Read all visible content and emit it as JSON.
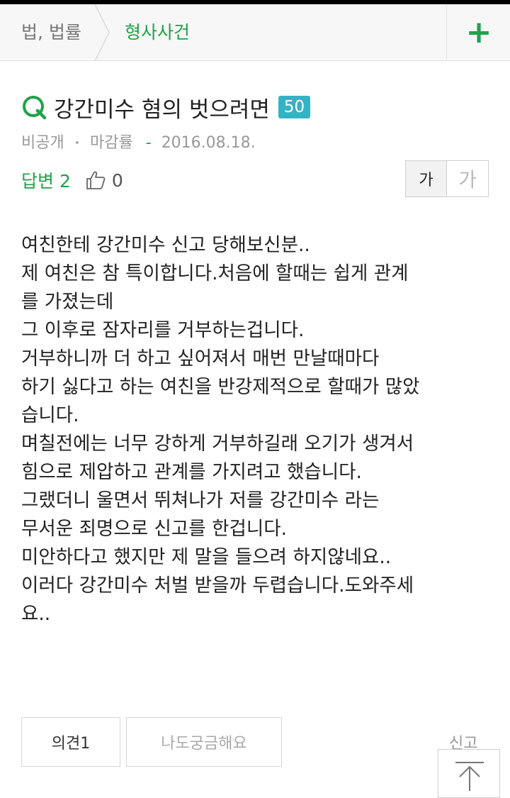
{
  "breadcrumb": {
    "category": "법, 법률",
    "subcategory": "형사사건",
    "add_symbol": "+"
  },
  "question": {
    "title": "강간미수 혐의 벗으려면",
    "points": "50",
    "author": "비공개",
    "close_rate_label": "마감률",
    "close_rate_value": "-",
    "date": "2016.08.18.",
    "answers_label": "답변 2",
    "likes": "0",
    "body_lines": [
      "여친한테 강간미수 신고 당해보신분..",
      "제 여친은 참 특이합니다.처음에 할때는 쉽게 관계",
      "를 가졌는데",
      "그 이후로 잠자리를 거부하는겁니다.",
      "거부하니까 더 하고 싶어져서 매번 만날때마다",
      "하기 싫다고 하는 여친을 반강제적으로 할때가 많았",
      "습니다.",
      "며칠전에는 너무 강하게 거부하길래 오기가 생겨서",
      "힘으로 제압하고 관계를 가지려고 했습니다.",
      "그랬더니 울면서 뛰쳐나가 저를 강간미수 라는",
      "무서운 죄명으로 신고를 한겁니다.",
      "미안하다고 했지만 제 말을 들으려 하지않네요..",
      "이러다 강간미수 처벌 받을까 두렵습니다.도와주세",
      "요.."
    ]
  },
  "font_size": {
    "small_label": "가",
    "large_label": "가"
  },
  "actions": {
    "opinion_label": "의견1",
    "curious_label": "나도궁금해요",
    "report_label": "신고"
  },
  "icons": {
    "question": "q-icon",
    "like": "thumb-up-icon",
    "top": "arrow-up-icon"
  },
  "colors": {
    "accent_green": "#1ea34a",
    "badge_teal": "#34b3c4"
  }
}
